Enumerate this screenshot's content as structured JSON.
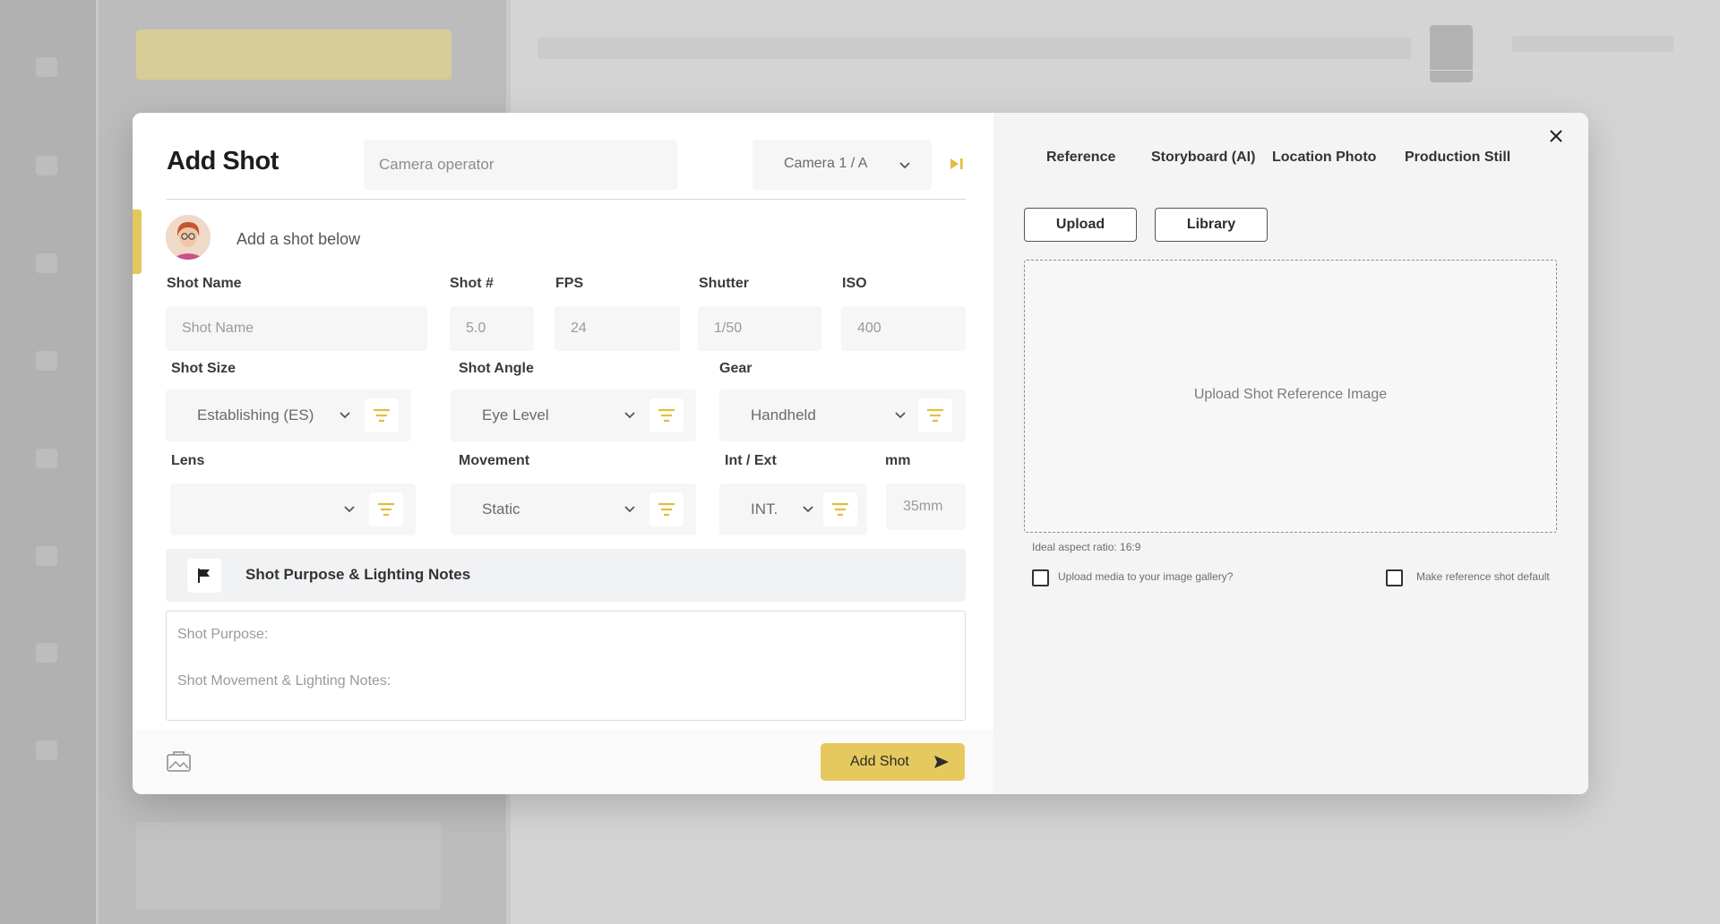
{
  "dialog": {
    "title": "Add Shot",
    "camera_operator_placeholder": "Camera operator",
    "camera_select": "Camera 1 / A",
    "hint": "Add a shot below"
  },
  "fields": {
    "shot_name_label": "Shot Name",
    "shot_name_placeholder": "Shot Name",
    "shot_num_label": "Shot #",
    "shot_num_value": "5.0",
    "fps_label": "FPS",
    "fps_value": "24",
    "shutter_label": "Shutter",
    "shutter_value": "1/50",
    "iso_label": "ISO",
    "iso_value": "400",
    "shot_size_label": "Shot Size",
    "shot_size_value": "Establishing (ES)",
    "shot_angle_label": "Shot Angle",
    "shot_angle_value": "Eye Level",
    "gear_label": "Gear",
    "gear_value": "Handheld",
    "lens_label": "Lens",
    "lens_value": "",
    "movement_label": "Movement",
    "movement_value": "Static",
    "int_ext_label": "Int / Ext",
    "int_ext_value": "INT.",
    "mm_label": "mm",
    "mm_value": "35mm"
  },
  "notes": {
    "heading": "Shot Purpose & Lighting Notes",
    "purpose_placeholder": "Shot Purpose:",
    "lighting_placeholder": "Shot Movement & Lighting Notes:"
  },
  "footer": {
    "add_button": "Add Shot"
  },
  "reference": {
    "tabs": [
      "Reference",
      "Storyboard (AI)",
      "Location Photo",
      "Production Still"
    ],
    "upload_button": "Upload",
    "library_button": "Library",
    "dropzone_text": "Upload Shot Reference Image",
    "aspect_note": "Ideal aspect ratio: 16:9",
    "gallery_checkbox": "Upload media to your image gallery?",
    "default_checkbox": "Make reference shot default"
  },
  "colors": {
    "accent": "#e6c95e",
    "overlay": "#c9c9c9"
  }
}
